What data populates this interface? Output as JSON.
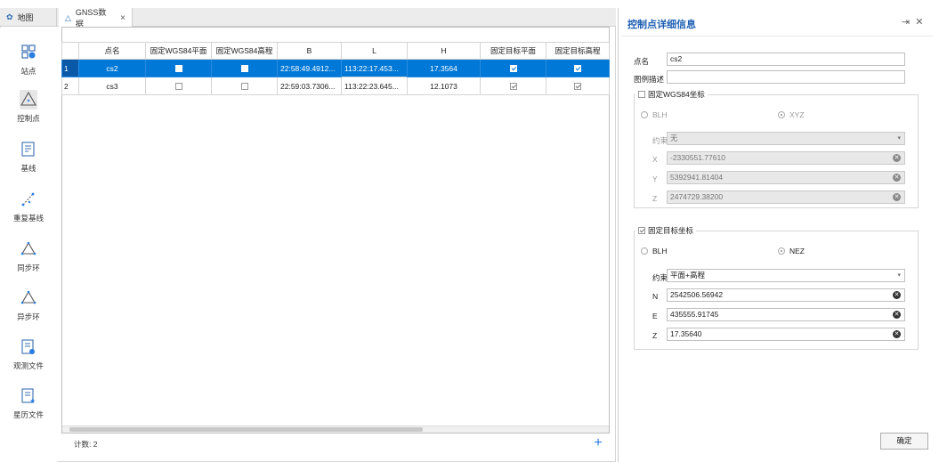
{
  "tabs": [
    {
      "label": "地图",
      "icon": "gear-icon"
    },
    {
      "label": "GNSS数据",
      "icon": "warning-triangle-icon"
    }
  ],
  "sidebar": [
    {
      "label": "站点",
      "icon": "station-icon"
    },
    {
      "label": "控制点",
      "icon": "control-point-icon"
    },
    {
      "label": "基线",
      "icon": "baseline-icon"
    },
    {
      "label": "重复基线",
      "icon": "repeat-baseline-icon"
    },
    {
      "label": "同步环",
      "icon": "sync-loop-icon"
    },
    {
      "label": "异步环",
      "icon": "async-loop-icon"
    },
    {
      "label": "观测文件",
      "icon": "observation-file-icon"
    },
    {
      "label": "星历文件",
      "icon": "ephemeris-file-icon"
    }
  ],
  "grid": {
    "headers": [
      "点名",
      "固定WGS84平面",
      "固定WGS84高程",
      "B",
      "L",
      "H",
      "固定目标平面",
      "固定目标高程"
    ],
    "rows": [
      {
        "num": "1",
        "name": "cs2",
        "b": "22:58:49.4912...",
        "l": "113:22:17.453...",
        "h": "17.3564",
        "fix_wgs_plane": false,
        "fix_wgs_height": false,
        "fix_target_plane": true,
        "fix_target_height": true
      },
      {
        "num": "2",
        "name": "cs3",
        "b": "22:59:03.7306...",
        "l": "113:22:23.645...",
        "h": "12.1073",
        "fix_wgs_plane": false,
        "fix_wgs_height": false,
        "fix_target_plane": true,
        "fix_target_height": true
      }
    ]
  },
  "footer": {
    "count": "计数: 2"
  },
  "panel": {
    "title": "控制点详细信息",
    "name_label": "点名",
    "name_value": "cs2",
    "desc_label": "图例描述",
    "desc_value": "",
    "wgs": {
      "title": "固定WGS84坐标",
      "radio_blh": "BLH",
      "radio_xyz": "XYZ",
      "constraint_label": "约束",
      "constraint_value": "无",
      "x_label": "X",
      "x_value": "-2330551.77610",
      "y_label": "Y",
      "y_value": "5392941.81404",
      "z_label": "Z",
      "z_value": "2474729.38200"
    },
    "target": {
      "title": "固定目标坐标",
      "radio_blh": "BLH",
      "radio_nez": "NEZ",
      "constraint_label": "约束",
      "constraint_value": "平面+高程",
      "n_label": "N",
      "n_value": "2542506.56942",
      "e_label": "E",
      "e_value": "435555.91745",
      "z_label": "Z",
      "z_value": "17.35640"
    },
    "ok_label": "确定"
  },
  "colors": {
    "accent": "#0078d7",
    "title": "#1d5fb3"
  }
}
